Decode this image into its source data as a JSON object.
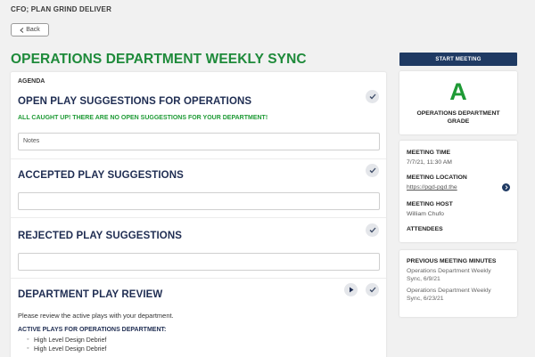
{
  "breadcrumb": "CFO; PLAN GRIND DELIVER",
  "back_label": "Back",
  "page_title": "OPERATIONS DEPARTMENT WEEKLY SYNC",
  "agenda": {
    "label": "AGENDA",
    "open_suggestions": {
      "title": "OPEN PLAY SUGGESTIONS FOR OPERATIONS",
      "message": "ALL CAUGHT UP! THERE ARE NO OPEN SUGGESTIONS FOR YOUR DEPARTMENT!",
      "notes_value": "Notes"
    },
    "accepted": {
      "title": "ACCEPTED PLAY SUGGESTIONS",
      "value": ""
    },
    "rejected": {
      "title": "REJECTED PLAY SUGGESTIONS",
      "value": ""
    },
    "review": {
      "title": "DEPARTMENT PLAY REVIEW",
      "instruction": "Please review the active plays with your department.",
      "active_head": "ACTIVE PLAYS FOR OPERATIONS DEPARTMENT:",
      "plays": [
        "High Level Design Debrief",
        "High Level Design Debrief"
      ]
    }
  },
  "sidebar": {
    "start_meeting": "START MEETING",
    "grade": {
      "letter": "A",
      "label_line1": "OPERATIONS DEPARTMENT",
      "label_line2": "GRADE"
    },
    "meeting_time_head": "MEETING TIME",
    "meeting_time": "7/7/21, 11:30 AM",
    "meeting_location_head": "MEETING LOCATION",
    "meeting_location": "https://pgd-pgd.the",
    "meeting_host_head": "MEETING HOST",
    "meeting_host": "William Chufo",
    "attendees_head": "ATTENDEES",
    "previous_minutes_head": "PREVIOUS MEETING MINUTES",
    "previous_minutes": [
      {
        "line1": "Operations Department Weekly",
        "line2": "Sync, 6/9/21"
      },
      {
        "line1": "Operations Department Weekly",
        "line2": "Sync, 6/23/21"
      }
    ]
  },
  "colors": {
    "accent_green": "#1e9a35",
    "navy": "#1f3a63",
    "heading_navy": "#1f2d52"
  },
  "icons": {
    "check": "check-icon",
    "play": "play-icon",
    "chevron": "chevron-left-icon",
    "arrow": "arrow-right-icon"
  }
}
